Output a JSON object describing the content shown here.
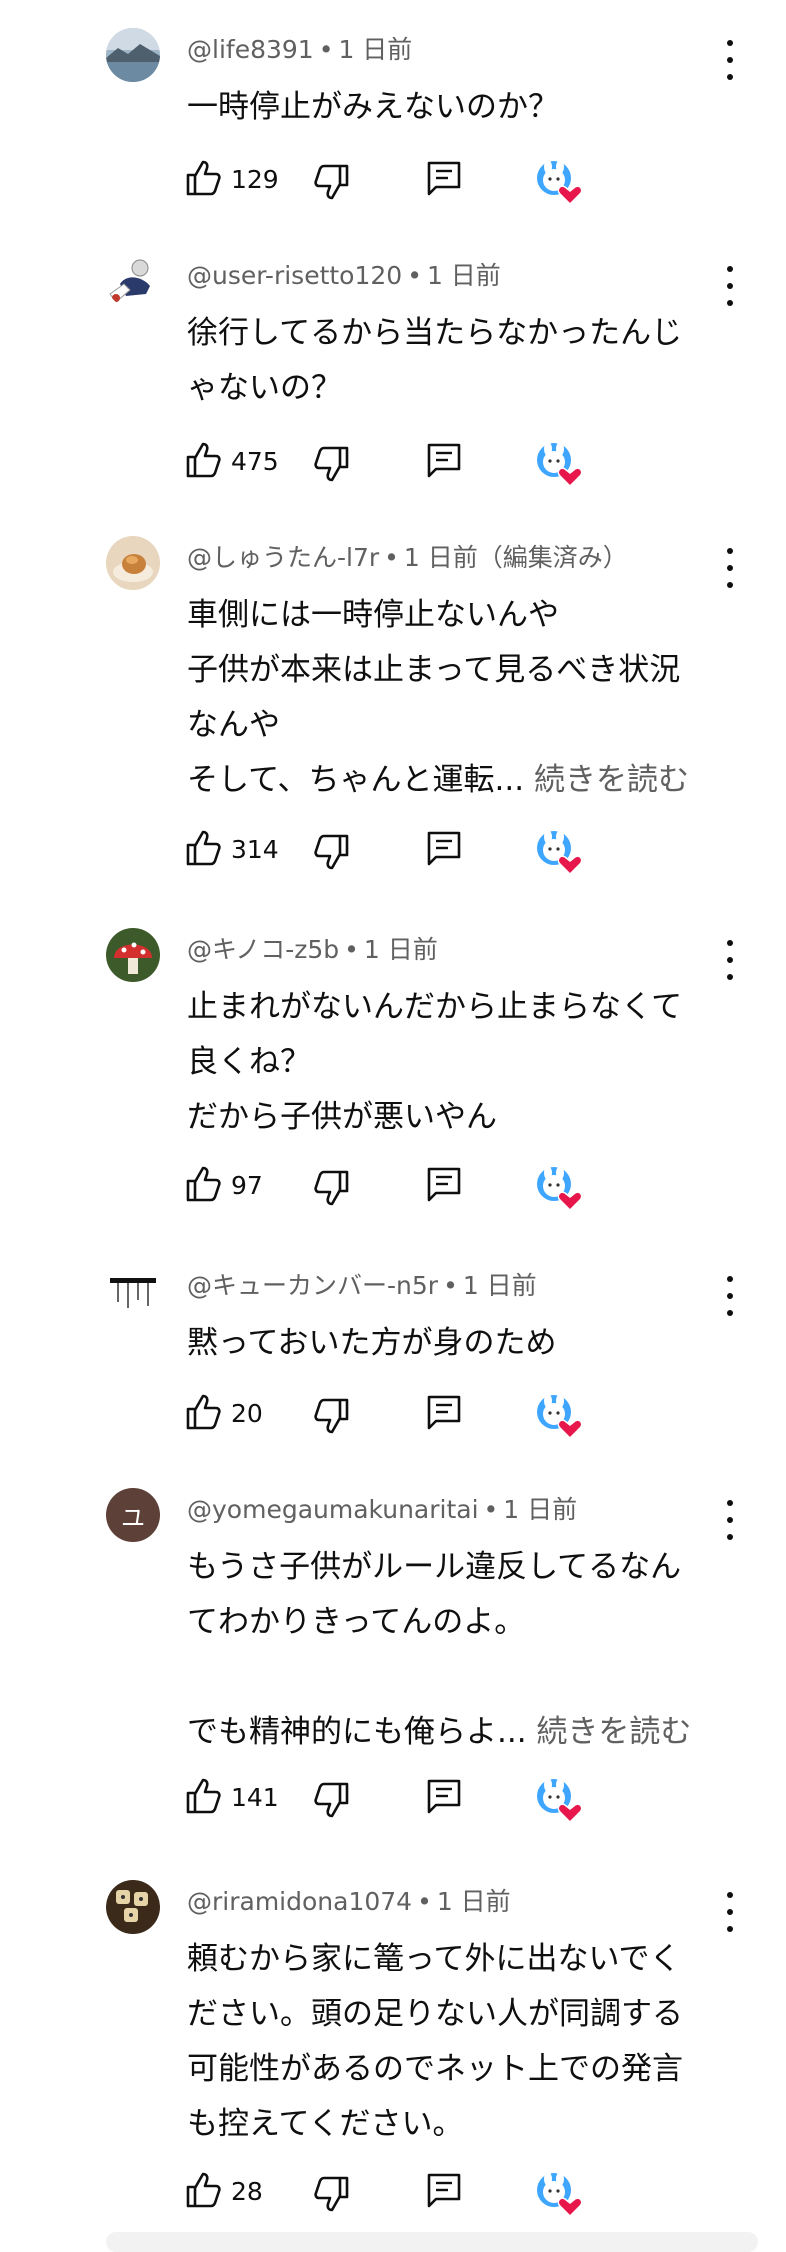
{
  "comments": [
    {
      "avatar_icon": "lake-landscape-avatar",
      "username": "@life8391",
      "time": "1 日前",
      "body_lines": [
        "一時停止がみえないのか？"
      ],
      "more_label": "",
      "likes": "129"
    },
    {
      "avatar_icon": "anime-character-avatar",
      "username": "@user-risetto120",
      "time": "1 日前",
      "body_lines": [
        "徐行してるから当たらなかったんじ",
        "ゃないの？"
      ],
      "more_label": "",
      "likes": "475"
    },
    {
      "avatar_icon": "food-photo-avatar",
      "username": "@しゅうたん-l7r",
      "time": "1 日前（編集済み）",
      "body_lines": [
        "車側には一時停止ないんや",
        "子供が本来は止まって見るべき状況",
        "なんや",
        "そして、ちゃんと運転..."
      ],
      "more_label": "続きを読む",
      "likes": "314"
    },
    {
      "avatar_icon": "mushroom-avatar",
      "username": "@キノコ-z5b",
      "time": "1 日前",
      "body_lines": [
        "止まれがないんだから止まらなくて",
        "良くね？",
        "だから子供が悪いやん"
      ],
      "more_label": "",
      "likes": "97"
    },
    {
      "avatar_icon": "sketch-avatar",
      "username": "@キューカンバー-n5r",
      "time": "1 日前",
      "body_lines": [
        "黙っておいた方が身のため"
      ],
      "more_label": "",
      "likes": "20"
    },
    {
      "avatar_icon": "letter-avatar",
      "avatar_letter": "ユ",
      "username": "@yomegaumakunaritai",
      "time": "1 日前",
      "body_lines": [
        "もうさ子供がルール違反してるなん",
        "てわかりきってんのよ。",
        "",
        "でも精神的にも俺らよ..."
      ],
      "more_label": "続きを読む",
      "likes": "141"
    },
    {
      "avatar_icon": "dice-avatar",
      "username": "@riramidona1074",
      "time": "1 日前",
      "body_lines": [
        "頼むから家に篭って外に出ないでく",
        "ださい。頭の足りない人が同調する",
        "可能性があるのでネット上での発言",
        "も控えてください。"
      ],
      "more_label": "",
      "likes": "28"
    }
  ],
  "colors": {
    "text": "#0f0f0f",
    "meta": "#606060",
    "heart": "#e8174b",
    "badge_bg": "#3ea6ff"
  }
}
